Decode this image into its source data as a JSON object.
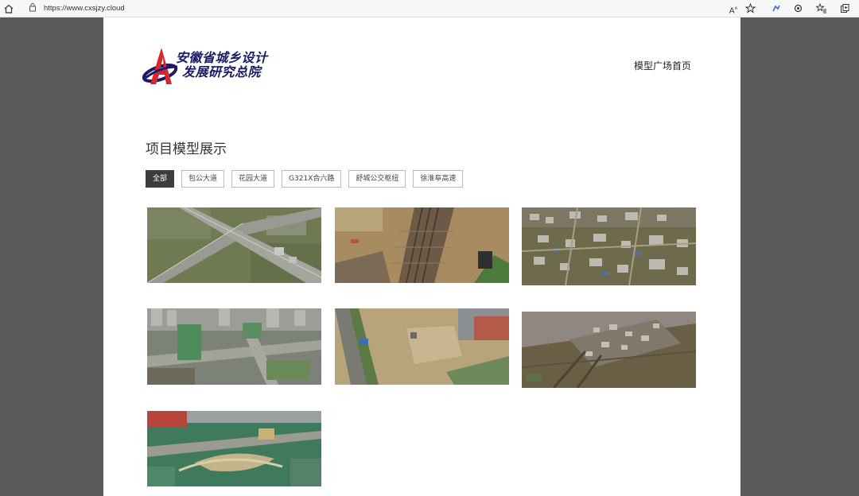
{
  "browser": {
    "url": "https://www.cxsjzy.cloud",
    "icons": [
      "home-icon",
      "lock-icon",
      "read-aloud-icon",
      "favorite-add-icon",
      "extension-icon",
      "settings-icon",
      "favorites-icon",
      "collections-icon"
    ]
  },
  "header": {
    "logo_line1": "安徽省城乡设计",
    "logo_line2": "发展研究总院",
    "nav_home": "模型广场首页"
  },
  "main": {
    "title": "项目模型展示",
    "filters": [
      "全部",
      "包公大道",
      "花园大道",
      "G321X合六路",
      "舒城公交枢纽",
      "徐淮阜高速"
    ],
    "active_filter": "全部"
  },
  "colors": {
    "background": "#5a5a5a",
    "logo_red": "#d8262c",
    "logo_blue": "#1a1a66",
    "active_filter": "#3c3c3c"
  }
}
